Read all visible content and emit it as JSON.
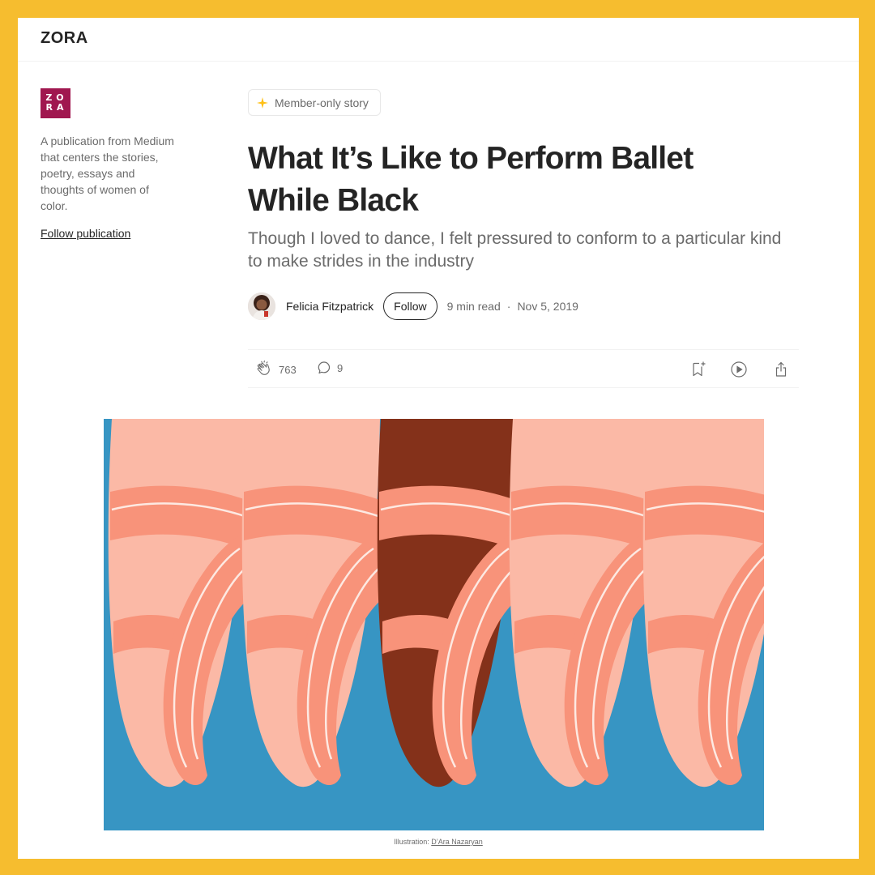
{
  "header": {
    "brand": "ZORA"
  },
  "sidebar": {
    "logo_letters": [
      "ZO",
      "RA"
    ],
    "description": "A publication from Medium that centers the stories, poetry, essays and thoughts of women of color.",
    "follow_label": "Follow publication"
  },
  "article": {
    "badge": "Member-only story",
    "title": "What It’s Like to Perform Ballet While Black",
    "subtitle": "Though I loved to dance, I felt pressured to conform to a particular kind to make strides in the industry",
    "author": "Felicia Fitzpatrick",
    "follow_label": "Follow",
    "read_time": "9 min read",
    "separator": "·",
    "date": "Nov 5, 2019"
  },
  "actions": {
    "claps": "763",
    "responses": "9"
  },
  "image": {
    "caption_prefix": "Illustration: ",
    "caption_credit": "D’Ara Nazaryan"
  },
  "colors": {
    "frame": "#f6bd2f",
    "publication": "#a0174f",
    "illustration_background": "#3795c3",
    "shoe_light": "#fbb9a6",
    "shoe_main": "#f8937a",
    "shoe_dark": "#84311a"
  }
}
